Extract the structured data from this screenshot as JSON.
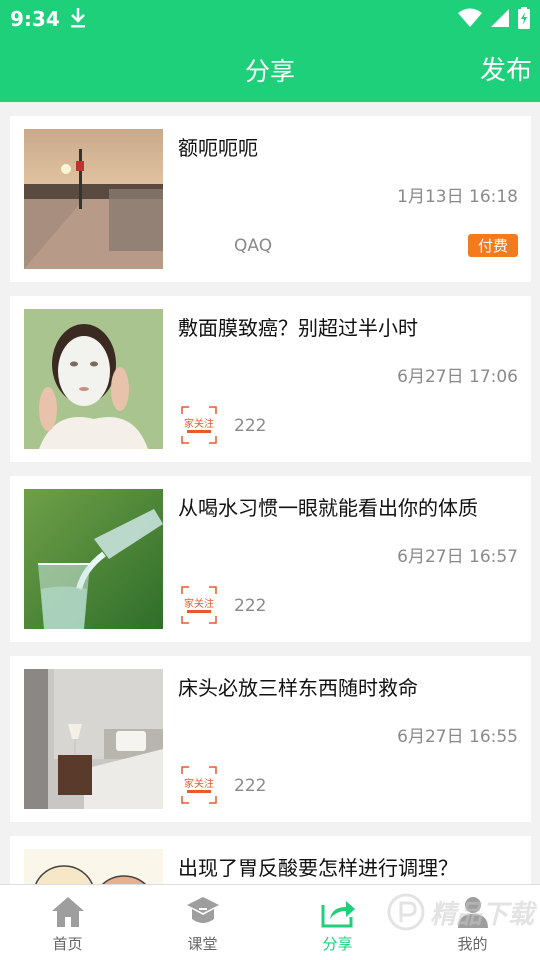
{
  "status_bar": {
    "time": "9:34"
  },
  "header": {
    "title": "分享",
    "publish_label": "发布"
  },
  "posts": [
    {
      "title": "额呃呃呃",
      "time": "1月13日 16:18",
      "author": "QAQ",
      "badge": "付费"
    },
    {
      "title": "敷面膜致癌？别超过半小时",
      "time": "6月27日 17:06",
      "author": "222",
      "source_logo_text": "家关注"
    },
    {
      "title": "从喝水习惯一眼就能看出你的体质",
      "time": "6月27日 16:57",
      "author": "222",
      "source_logo_text": "家关注"
    },
    {
      "title": "床头必放三样东西随时救命",
      "time": "6月27日 16:55",
      "author": "222",
      "source_logo_text": "家关注"
    },
    {
      "title": "出现了胃反酸要怎样进行调理？"
    }
  ],
  "bottom_nav": {
    "items": [
      {
        "label": "首页",
        "icon": "home-icon"
      },
      {
        "label": "课堂",
        "icon": "classroom-icon"
      },
      {
        "label": "分享",
        "icon": "share-icon",
        "active": true
      },
      {
        "label": "我的",
        "icon": "profile-icon"
      }
    ]
  },
  "watermark": {
    "text": "精品下载"
  },
  "colors": {
    "accent": "#1fd07a",
    "badge": "#f37b1d",
    "source_logo": "#e85a2a"
  }
}
